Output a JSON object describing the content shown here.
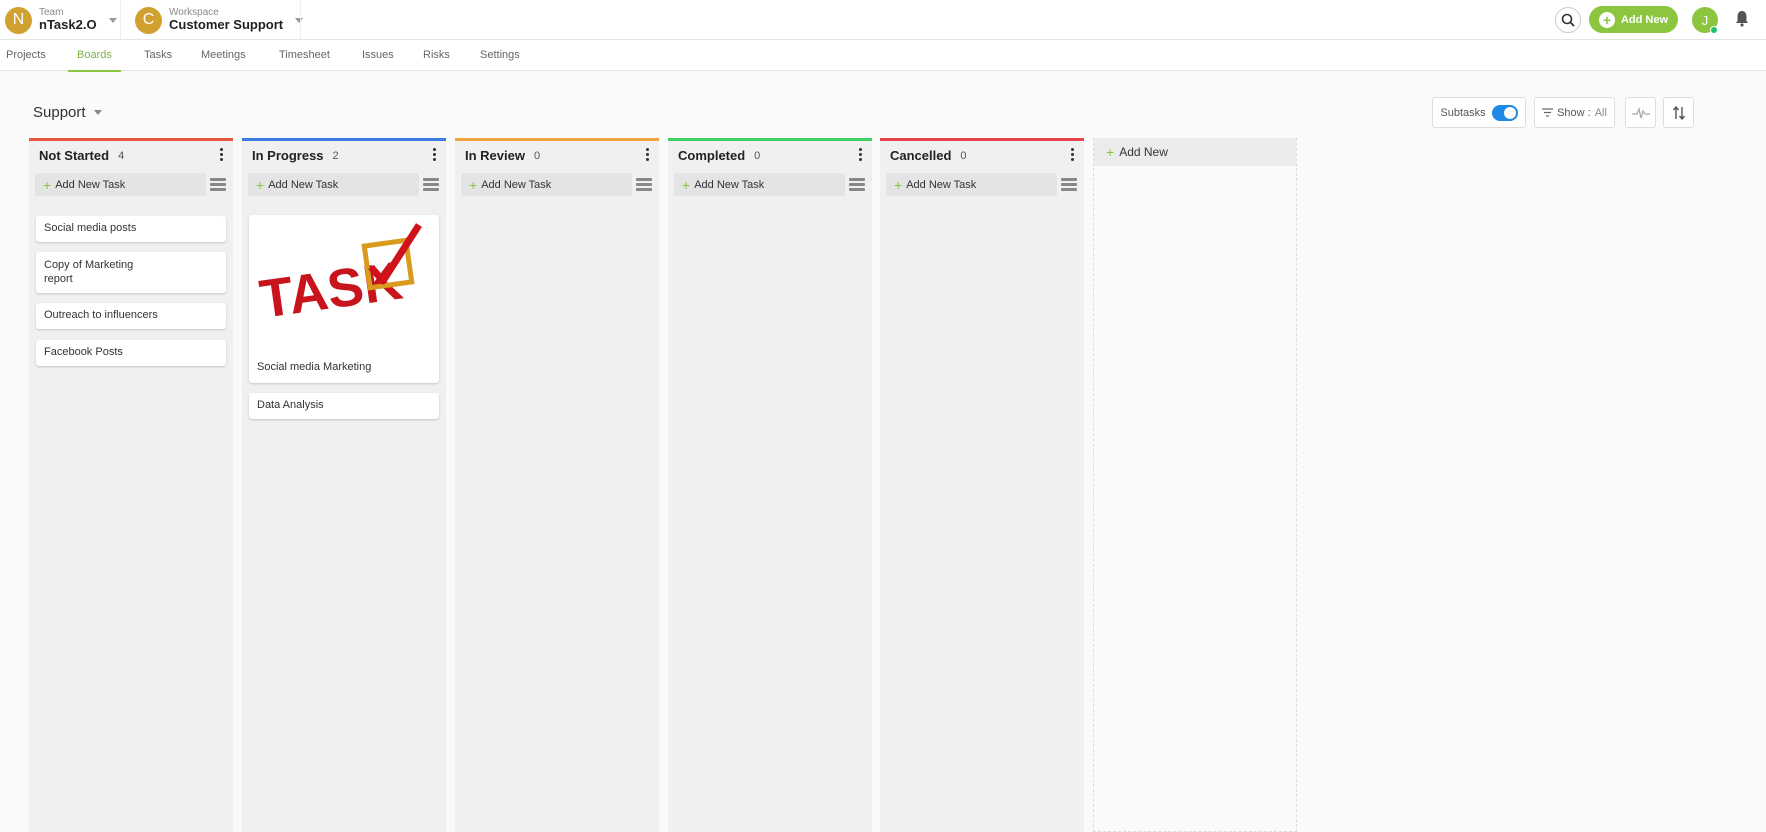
{
  "topbar": {
    "team": {
      "avatar": "N",
      "label": "Team",
      "name": "nTask2.O"
    },
    "workspace": {
      "avatar": "C",
      "label": "Workspace",
      "name": "Customer Support"
    },
    "add_new_label": "Add New",
    "user_avatar": "J"
  },
  "nav": {
    "tabs": [
      "Projects",
      "Boards",
      "Tasks",
      "Meetings",
      "Timesheet",
      "Issues",
      "Risks",
      "Settings"
    ],
    "active": "Boards"
  },
  "board": {
    "title": "Support",
    "subtasks_label": "Subtasks",
    "subtasks_on": true,
    "show_label": "Show :",
    "show_value": "All"
  },
  "columns": [
    {
      "title": "Not Started",
      "count": "4",
      "color": "#e8543f",
      "add_task": "Add New Task",
      "cards": [
        {
          "text": "Social media posts"
        },
        {
          "text": "Copy of Marketing report"
        },
        {
          "text": "Outreach to influencers"
        },
        {
          "text": "Facebook Posts"
        }
      ]
    },
    {
      "title": "In Progress",
      "count": "2",
      "color": "#3c7de0",
      "add_task": "Add New Task",
      "cards": [
        {
          "text": "Social media Marketing",
          "image": "TASK"
        },
        {
          "text": "Data Analysis"
        }
      ]
    },
    {
      "title": "In Review",
      "count": "0",
      "color": "#f0a03c",
      "add_task": "Add New Task",
      "cards": []
    },
    {
      "title": "Completed",
      "count": "0",
      "color": "#3ccf63",
      "add_task": "Add New Task",
      "cards": []
    },
    {
      "title": "Cancelled",
      "count": "0",
      "color": "#e8454a",
      "add_task": "Add New Task",
      "cards": []
    }
  ],
  "add_column_label": "Add New",
  "colors": {
    "accent": "#8cc63f",
    "team_avatar": "#d1a12f",
    "toggle": "#1e88e5"
  },
  "icons": [
    "search-icon",
    "plus-icon",
    "bell-icon",
    "chevron-down-icon",
    "filter-icon",
    "activity-icon",
    "sort-icon",
    "kebab-icon",
    "list-view-icon"
  ]
}
